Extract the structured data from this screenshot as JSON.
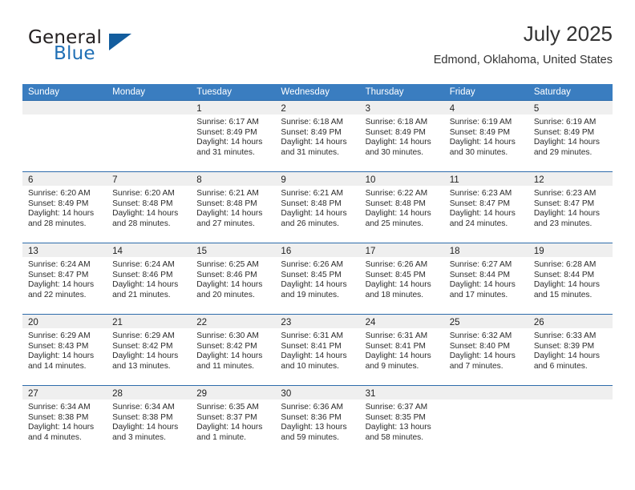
{
  "brand": {
    "word1": "General",
    "word2": "Blue",
    "triangle_color": "#135d9e",
    "blue_color": "#1f6fb5"
  },
  "header": {
    "title": "July 2025",
    "location": "Edmond, Oklahoma, United States"
  },
  "theme": {
    "header_blue": "#3a7dc0",
    "row_border_blue": "#2e6cab",
    "daynum_band": "#efefef"
  },
  "weekdays": [
    "Sunday",
    "Monday",
    "Tuesday",
    "Wednesday",
    "Thursday",
    "Friday",
    "Saturday"
  ],
  "weeks": [
    [
      {
        "day": "",
        "lines": []
      },
      {
        "day": "",
        "lines": []
      },
      {
        "day": "1",
        "lines": [
          "Sunrise: 6:17 AM",
          "Sunset: 8:49 PM",
          "Daylight: 14 hours",
          "and 31 minutes."
        ]
      },
      {
        "day": "2",
        "lines": [
          "Sunrise: 6:18 AM",
          "Sunset: 8:49 PM",
          "Daylight: 14 hours",
          "and 31 minutes."
        ]
      },
      {
        "day": "3",
        "lines": [
          "Sunrise: 6:18 AM",
          "Sunset: 8:49 PM",
          "Daylight: 14 hours",
          "and 30 minutes."
        ]
      },
      {
        "day": "4",
        "lines": [
          "Sunrise: 6:19 AM",
          "Sunset: 8:49 PM",
          "Daylight: 14 hours",
          "and 30 minutes."
        ]
      },
      {
        "day": "5",
        "lines": [
          "Sunrise: 6:19 AM",
          "Sunset: 8:49 PM",
          "Daylight: 14 hours",
          "and 29 minutes."
        ]
      }
    ],
    [
      {
        "day": "6",
        "lines": [
          "Sunrise: 6:20 AM",
          "Sunset: 8:49 PM",
          "Daylight: 14 hours",
          "and 28 minutes."
        ]
      },
      {
        "day": "7",
        "lines": [
          "Sunrise: 6:20 AM",
          "Sunset: 8:48 PM",
          "Daylight: 14 hours",
          "and 28 minutes."
        ]
      },
      {
        "day": "8",
        "lines": [
          "Sunrise: 6:21 AM",
          "Sunset: 8:48 PM",
          "Daylight: 14 hours",
          "and 27 minutes."
        ]
      },
      {
        "day": "9",
        "lines": [
          "Sunrise: 6:21 AM",
          "Sunset: 8:48 PM",
          "Daylight: 14 hours",
          "and 26 minutes."
        ]
      },
      {
        "day": "10",
        "lines": [
          "Sunrise: 6:22 AM",
          "Sunset: 8:48 PM",
          "Daylight: 14 hours",
          "and 25 minutes."
        ]
      },
      {
        "day": "11",
        "lines": [
          "Sunrise: 6:23 AM",
          "Sunset: 8:47 PM",
          "Daylight: 14 hours",
          "and 24 minutes."
        ]
      },
      {
        "day": "12",
        "lines": [
          "Sunrise: 6:23 AM",
          "Sunset: 8:47 PM",
          "Daylight: 14 hours",
          "and 23 minutes."
        ]
      }
    ],
    [
      {
        "day": "13",
        "lines": [
          "Sunrise: 6:24 AM",
          "Sunset: 8:47 PM",
          "Daylight: 14 hours",
          "and 22 minutes."
        ]
      },
      {
        "day": "14",
        "lines": [
          "Sunrise: 6:24 AM",
          "Sunset: 8:46 PM",
          "Daylight: 14 hours",
          "and 21 minutes."
        ]
      },
      {
        "day": "15",
        "lines": [
          "Sunrise: 6:25 AM",
          "Sunset: 8:46 PM",
          "Daylight: 14 hours",
          "and 20 minutes."
        ]
      },
      {
        "day": "16",
        "lines": [
          "Sunrise: 6:26 AM",
          "Sunset: 8:45 PM",
          "Daylight: 14 hours",
          "and 19 minutes."
        ]
      },
      {
        "day": "17",
        "lines": [
          "Sunrise: 6:26 AM",
          "Sunset: 8:45 PM",
          "Daylight: 14 hours",
          "and 18 minutes."
        ]
      },
      {
        "day": "18",
        "lines": [
          "Sunrise: 6:27 AM",
          "Sunset: 8:44 PM",
          "Daylight: 14 hours",
          "and 17 minutes."
        ]
      },
      {
        "day": "19",
        "lines": [
          "Sunrise: 6:28 AM",
          "Sunset: 8:44 PM",
          "Daylight: 14 hours",
          "and 15 minutes."
        ]
      }
    ],
    [
      {
        "day": "20",
        "lines": [
          "Sunrise: 6:29 AM",
          "Sunset: 8:43 PM",
          "Daylight: 14 hours",
          "and 14 minutes."
        ]
      },
      {
        "day": "21",
        "lines": [
          "Sunrise: 6:29 AM",
          "Sunset: 8:42 PM",
          "Daylight: 14 hours",
          "and 13 minutes."
        ]
      },
      {
        "day": "22",
        "lines": [
          "Sunrise: 6:30 AM",
          "Sunset: 8:42 PM",
          "Daylight: 14 hours",
          "and 11 minutes."
        ]
      },
      {
        "day": "23",
        "lines": [
          "Sunrise: 6:31 AM",
          "Sunset: 8:41 PM",
          "Daylight: 14 hours",
          "and 10 minutes."
        ]
      },
      {
        "day": "24",
        "lines": [
          "Sunrise: 6:31 AM",
          "Sunset: 8:41 PM",
          "Daylight: 14 hours",
          "and 9 minutes."
        ]
      },
      {
        "day": "25",
        "lines": [
          "Sunrise: 6:32 AM",
          "Sunset: 8:40 PM",
          "Daylight: 14 hours",
          "and 7 minutes."
        ]
      },
      {
        "day": "26",
        "lines": [
          "Sunrise: 6:33 AM",
          "Sunset: 8:39 PM",
          "Daylight: 14 hours",
          "and 6 minutes."
        ]
      }
    ],
    [
      {
        "day": "27",
        "lines": [
          "Sunrise: 6:34 AM",
          "Sunset: 8:38 PM",
          "Daylight: 14 hours",
          "and 4 minutes."
        ]
      },
      {
        "day": "28",
        "lines": [
          "Sunrise: 6:34 AM",
          "Sunset: 8:38 PM",
          "Daylight: 14 hours",
          "and 3 minutes."
        ]
      },
      {
        "day": "29",
        "lines": [
          "Sunrise: 6:35 AM",
          "Sunset: 8:37 PM",
          "Daylight: 14 hours",
          "and 1 minute."
        ]
      },
      {
        "day": "30",
        "lines": [
          "Sunrise: 6:36 AM",
          "Sunset: 8:36 PM",
          "Daylight: 13 hours",
          "and 59 minutes."
        ]
      },
      {
        "day": "31",
        "lines": [
          "Sunrise: 6:37 AM",
          "Sunset: 8:35 PM",
          "Daylight: 13 hours",
          "and 58 minutes."
        ]
      },
      {
        "day": "",
        "lines": []
      },
      {
        "day": "",
        "lines": []
      }
    ]
  ]
}
